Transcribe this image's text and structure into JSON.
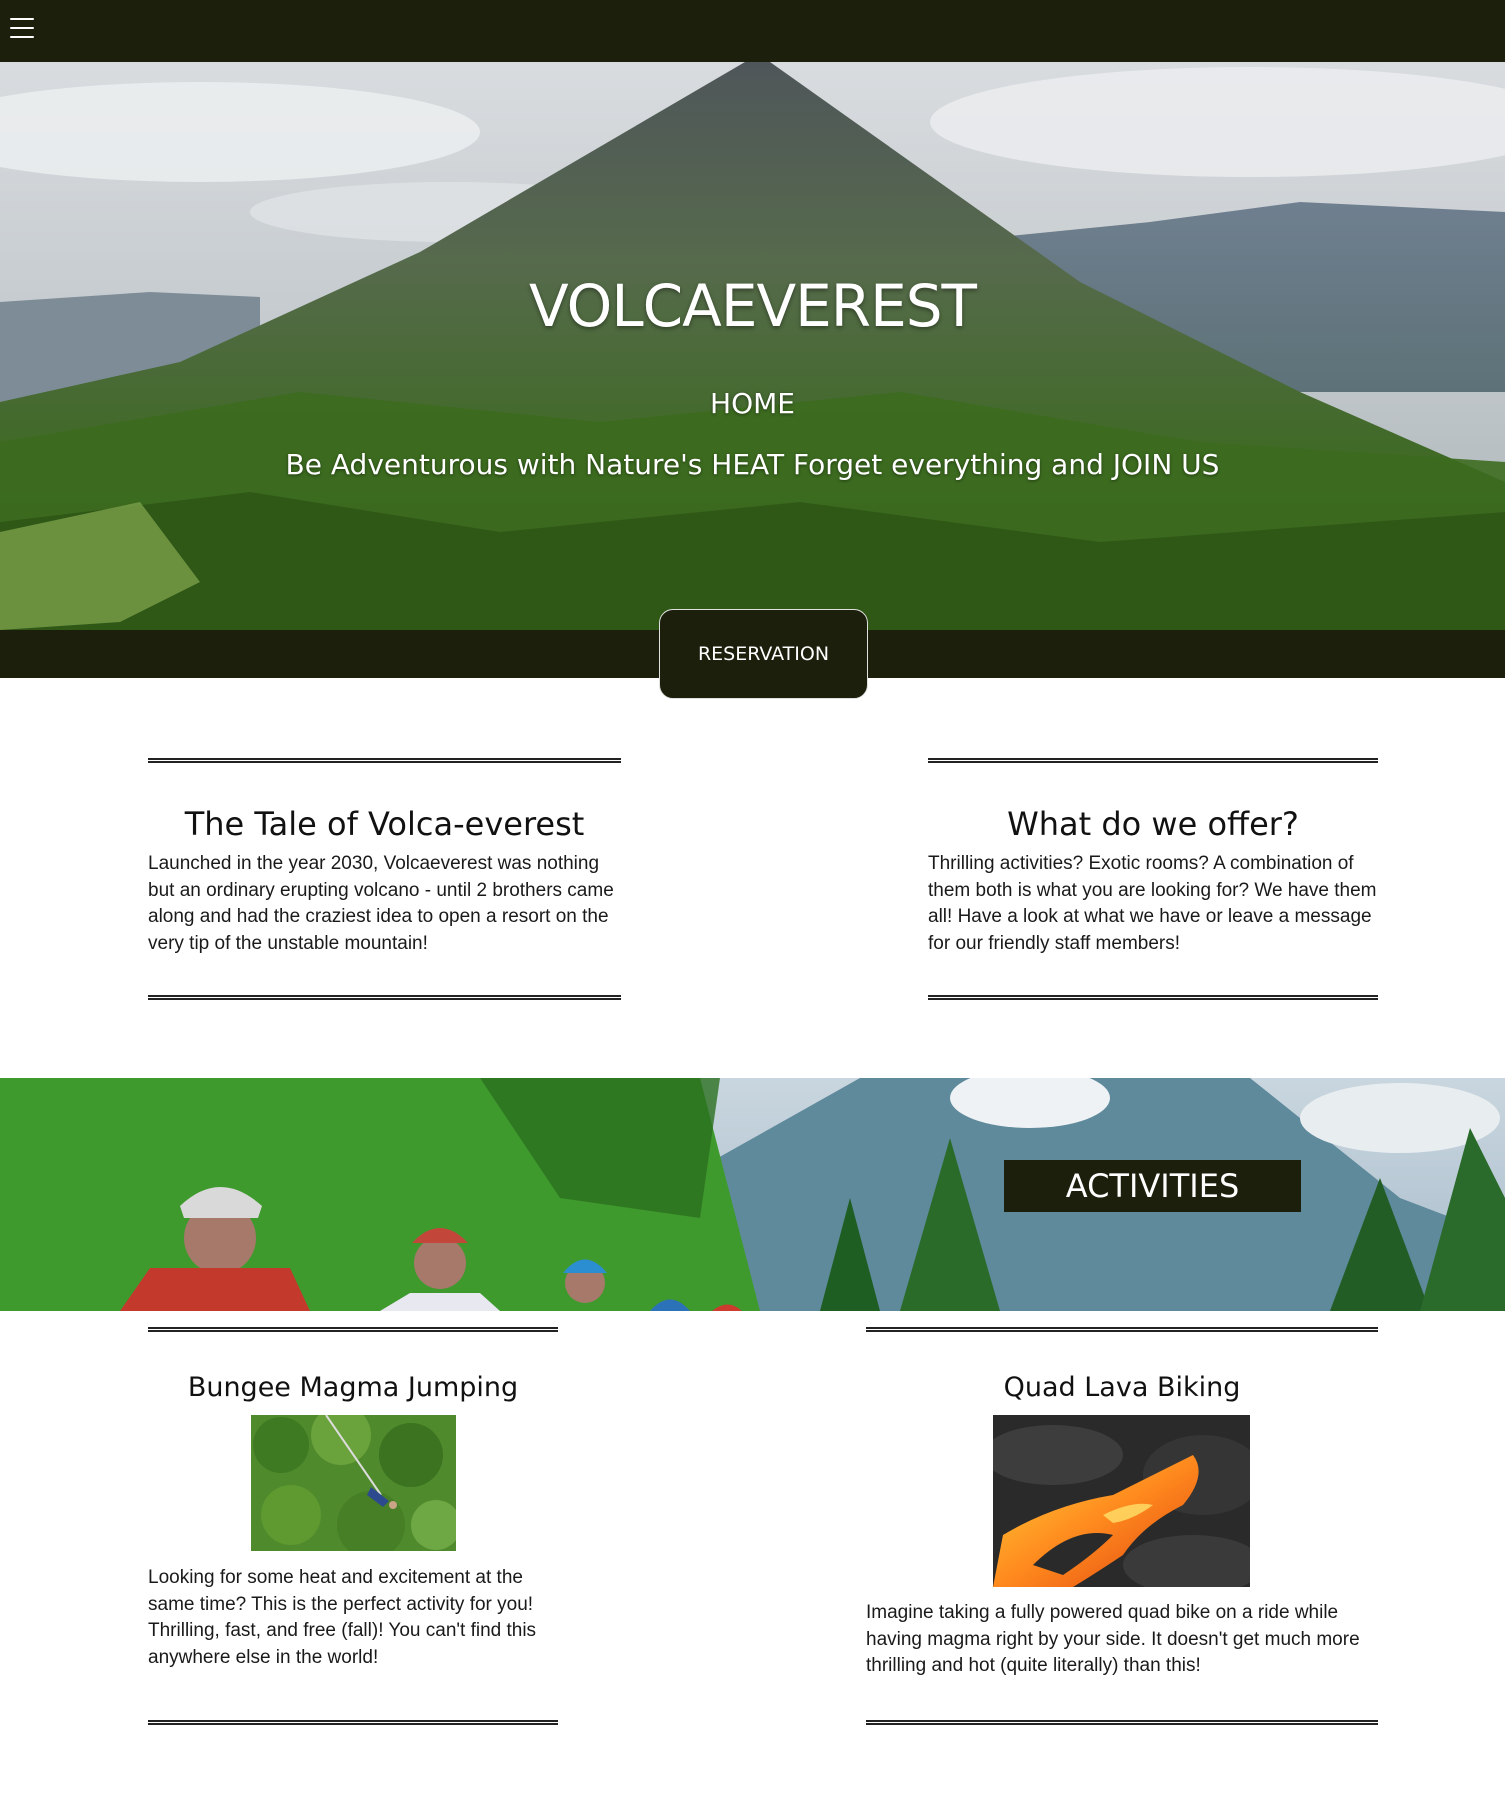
{
  "nav": {
    "menu_icon": "hamburger-menu-icon"
  },
  "hero": {
    "title": "VOLCAEVEREST",
    "home_label": "HOME",
    "tagline": "Be Adventurous with Nature's HEAT Forget everything and JOIN US",
    "reservation_label": "RESERVATION"
  },
  "about": [
    {
      "title": "The Tale of Volca-everest",
      "text": "Launched in the year 2030, Volcaeverest was nothing but an ordinary erupting volcano - until 2 brothers came along and had the craziest idea to open a resort on the very tip of the unstable mountain!"
    },
    {
      "title": "What do we offer?",
      "text": "Thrilling activities? Exotic rooms? A combination of them both is what you are looking for? We have them all! Have a look at what we have or leave a message for our friendly staff members!"
    }
  ],
  "activities": {
    "banner_label": "ACTIVITIES",
    "items": [
      {
        "title": "Bungee Magma Jumping",
        "text": "Looking for some heat and excitement at the same time? This is the perfect activity for you! Thrilling, fast, and free (fall)! You can't find this anywhere else in the world!"
      },
      {
        "title": "Quad Lava Biking",
        "text": "Imagine taking a fully powered quad bike on a ride while having magma right by your side. It doesn't get much more thrilling and hot (quite literally) than this!"
      }
    ]
  },
  "colors": {
    "dark": "#1b1f0c",
    "white": "#ffffff",
    "text": "#1a1a1a"
  }
}
